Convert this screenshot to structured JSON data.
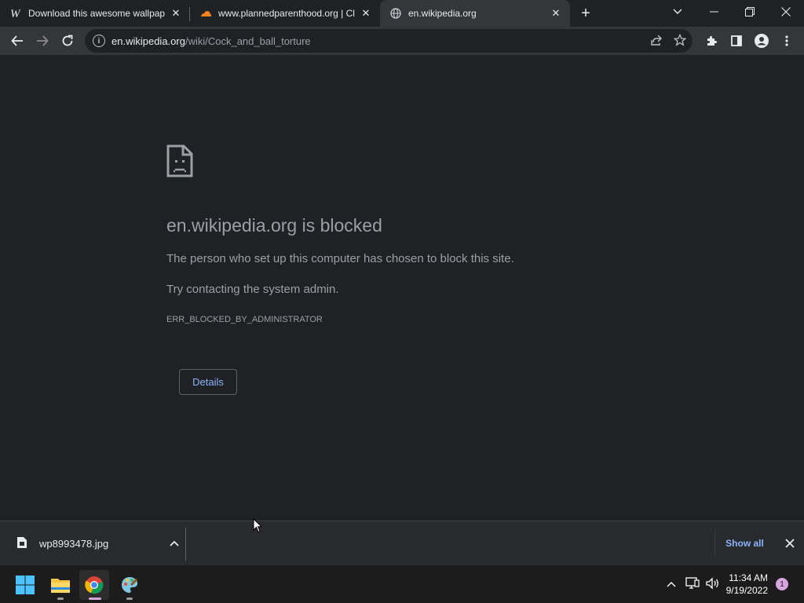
{
  "tabs": [
    {
      "title": "Download this awesome wallpap",
      "icon": "wallpaper-w-icon",
      "active": false
    },
    {
      "title": "www.plannedparenthood.org | Cl",
      "icon": "cloudflare-icon",
      "active": false
    },
    {
      "title": "en.wikipedia.org",
      "icon": "globe-icon",
      "active": true
    }
  ],
  "toolbar": {
    "url_host": "en.wikipedia.org",
    "url_path": "/wiki/Cock_and_ball_torture"
  },
  "error": {
    "heading": "en.wikipedia.org is blocked",
    "message": "The person who set up this computer has chosen to block this site.",
    "suggestion": "Try contacting the system admin.",
    "code": "ERR_BLOCKED_BY_ADMINISTRATOR",
    "details_label": "Details"
  },
  "downloads": {
    "filename": "wp8993478.jpg",
    "show_all_label": "Show all"
  },
  "taskbar": {
    "time": "11:34 AM",
    "date": "9/19/2022",
    "notifications": "1"
  },
  "colors": {
    "accent_link": "#8ab4f8",
    "page_bg": "#202124",
    "toolbar_bg": "#35363a"
  }
}
